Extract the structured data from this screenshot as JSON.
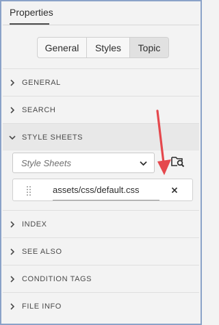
{
  "panel": {
    "title": "Properties"
  },
  "tabs": [
    {
      "label": "General"
    },
    {
      "label": "Styles"
    },
    {
      "label": "Topic",
      "selected": true
    }
  ],
  "sections": {
    "general": "GENERAL",
    "search": "SEARCH",
    "style_sheets": "STYLE SHEETS",
    "index": "INDEX",
    "see_also": "SEE ALSO",
    "condition_tags": "CONDITION TAGS",
    "file_info": "FILE INFO"
  },
  "style_sheets": {
    "dropdown_placeholder": "Style Sheets",
    "files": [
      {
        "name": "assets/css/default.css"
      }
    ]
  },
  "colors": {
    "annotation_arrow": "#e5484d",
    "frame_border": "#8aa2c8",
    "selected_tab": "#e1e1e1"
  },
  "icons": {
    "section_collapsed": "chevron-right-icon",
    "section_expanded": "chevron-down-icon",
    "dropdown": "chevron-down-icon",
    "browse": "folder-search-icon",
    "remove": "close-icon",
    "reorder": "drag-handle-icon"
  }
}
